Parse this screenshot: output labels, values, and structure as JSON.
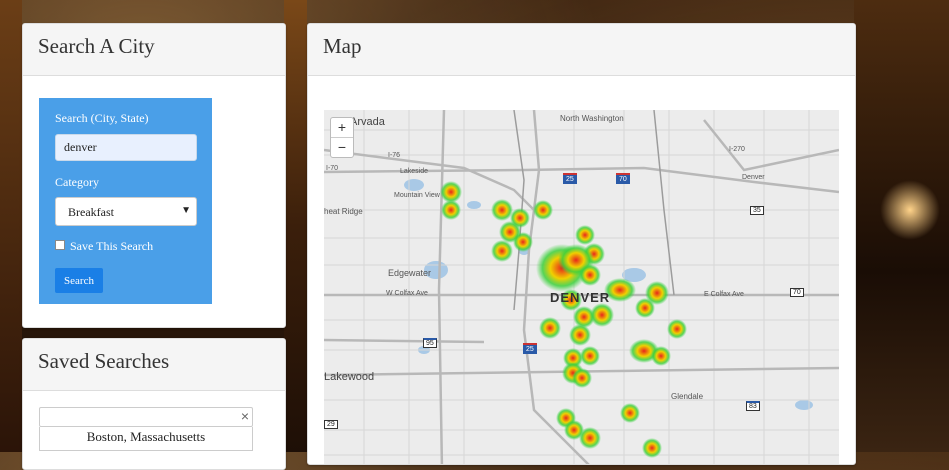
{
  "search_panel": {
    "title": "Search A City",
    "city_label": "Search (City, State)",
    "city_value": "denver",
    "category_label": "Category",
    "category_selected": "Breakfast",
    "save_label": "Save This Search",
    "save_checked": false,
    "search_button": "Search"
  },
  "map_panel": {
    "title": "Map",
    "zoom_in": "+",
    "zoom_out": "−",
    "place_labels": {
      "arvada": "Arvada",
      "north_washington": "North Washington",
      "lakeside": "Lakeside",
      "mountain_view": "Mountain View",
      "wheat_ridge": "heat Ridge",
      "edgewater": "Edgewater",
      "w_colfax": "W Colfax Ave",
      "e_colfax": "E Colfax Ave",
      "denver": "DENVER",
      "lakewood": "Lakewood",
      "glendale": "Glendale",
      "denver_east": "Denver",
      "i70": "I-70",
      "i76": "I-76",
      "i270": "I-270"
    },
    "shields": {
      "i25_north": "25",
      "i70": "70",
      "us35": "35",
      "r70": "70",
      "us95": "95",
      "i25_south": "25",
      "us83": "83",
      "r29": "29"
    }
  },
  "saved_panel": {
    "title": "Saved Searches",
    "clear_icon": "×",
    "items": [
      "Boston, Massachusetts"
    ]
  },
  "colors": {
    "accent_blue": "#4a9fe8",
    "button_blue": "#1a7fe6",
    "heat_red": "#e8251c",
    "heat_green": "#3cd03c"
  }
}
